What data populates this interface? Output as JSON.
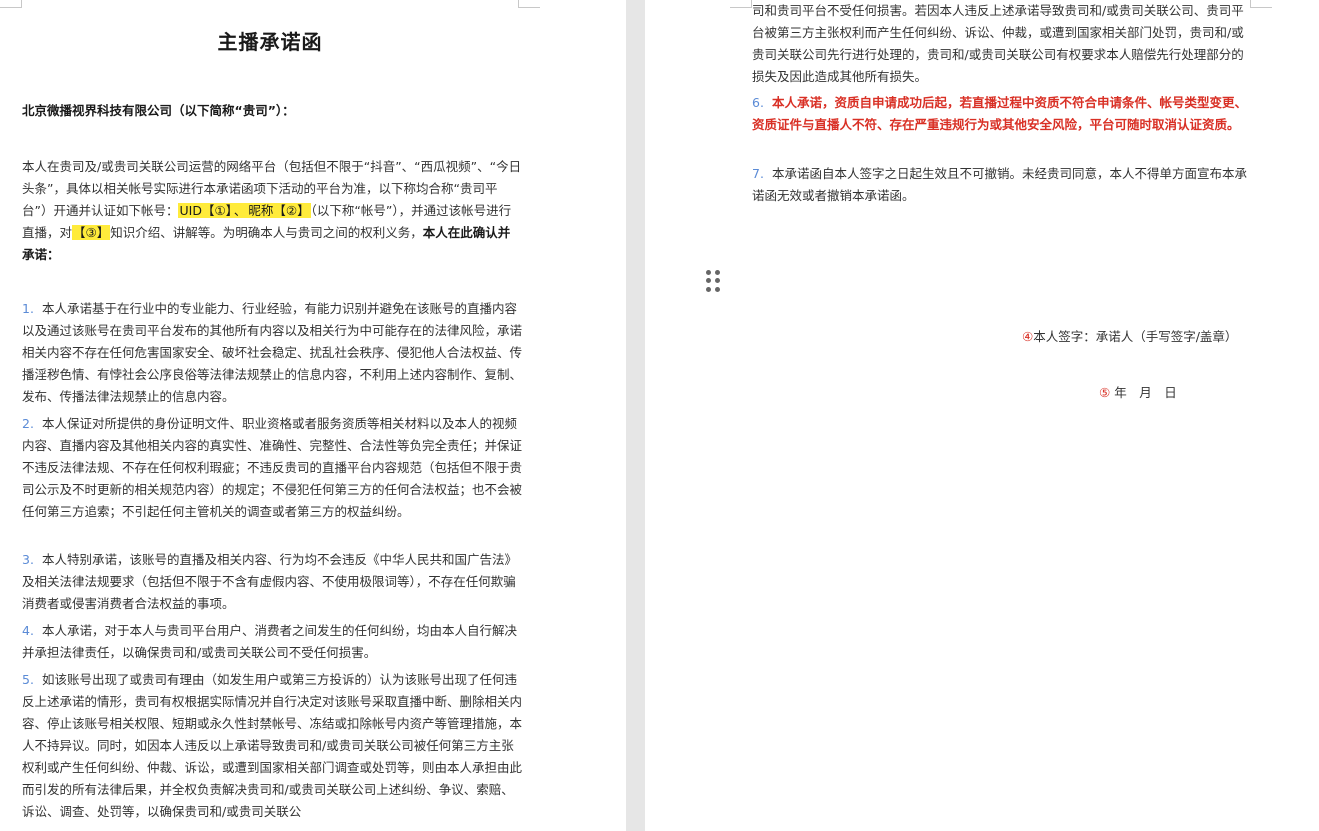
{
  "left_page": {
    "title": "主播承诺函",
    "addressee": "北京微播视界科技有限公司（以下简称“贵司”）：",
    "intro": {
      "part1": "本人在贵司及/或贵司关联公司运营的网络平台（包括但不限于“抖音”、“西瓜视频”、“今日头条”，具体以相关帐号实际进行本承诺函项下活动的平台为准，以下称均合称“贵司平台”）开通并认证如下帐号：",
      "uid_field": "UID【①】",
      "sep": "、",
      "nickname_field": "昵称【②】",
      "part2": "（以下称“帐号”），并通过该帐号进行直播，对",
      "topic_field": "【③】",
      "part3": "知识介绍、讲解等。为明确本人与贵司之间的权利义务，",
      "part4": "本人在此确认并承诺："
    },
    "items": [
      {
        "num": "1.",
        "text": "本人承诺基于在行业中的专业能力、行业经验，有能力识别并避免在该账号的直播内容以及通过该账号在贵司平台发布的其他所有内容以及相关行为中可能存在的法律风险，承诺相关内容不存在任何危害国家安全、破坏社会稳定、扰乱社会秩序、侵犯他人合法权益、传播淫秽色情、有悖社会公序良俗等法律法规禁止的信息内容，不利用上述内容制作、复制、发布、传播法律法规禁止的信息内容。"
      },
      {
        "num": "2.",
        "text": "本人保证对所提供的身份证明文件、职业资格或者服务资质等相关材料以及本人的视频内容、直播内容及其他相关内容的真实性、准确性、完整性、合法性等负完全责任；并保证不违反法律法规、不存在任何权利瑕疵；不违反贵司的直播平台内容规范（包括但不限于贵司公示及不时更新的相关规范内容）的规定；不侵犯任何第三方的任何合法权益；也不会被任何第三方追索；不引起任何主管机关的调查或者第三方的权益纠纷。"
      },
      {
        "num": "3.",
        "text": "本人特别承诺，该账号的直播及相关内容、行为均不会违反《中华人民共和国广告法》及相关法律法规要求（包括但不限于不含有虚假内容、不使用极限词等），不存在任何欺骗消费者或侵害消费者合法权益的事项。"
      },
      {
        "num": "4.",
        "text": "本人承诺，对于本人与贵司平台用户、消费者之间发生的任何纠纷，均由本人自行解决并承担法律责任，以确保贵司和/或贵司关联公司不受任何损害。"
      },
      {
        "num": "5.",
        "text": "如该账号出现了或贵司有理由（如发生用户或第三方投诉的）认为该账号出现了任何违反上述承诺的情形，贵司有权根据实际情况并自行决定对该账号采取直播中断、删除相关内容、停止该账号相关权限、短期或永久性封禁帐号、冻结或扣除帐号内资产等管理措施，本人不持异议。同时，如因本人违反以上承诺导致贵司和/或贵司关联公司被任何第三方主张权利或产生任何纠纷、仲裁、诉讼，或遭到国家相关部门调查或处罚等，则由本人承担由此而引发的所有法律后果，并全权负责解决贵司和/或贵司关联公司上述纠纷、争议、索赔、诉讼、调查、处罚等，以确保贵司和/或贵司关联公"
      }
    ]
  },
  "right_page": {
    "continuation": "司和贵司平台不受任何损害。若因本人违反上述承诺导致贵司和/或贵司关联公司、贵司平台被第三方主张权利而产生任何纠纷、诉讼、仲裁，或遭到国家相关部门处罚，贵司和/或贵司关联公司先行进行处理的，贵司和/或贵司关联公司有权要求本人赔偿先行处理部分的损失及因此造成其他所有损失。",
    "items": [
      {
        "num": "6.",
        "text": "本人承诺，资质自申请成功后起，若直播过程中资质不符合申请条件、帐号类型变更、资质证件与直播人不符、存在严重违规行为或其他安全风险，平台可随时取消认证资质。"
      },
      {
        "num": "7.",
        "text": "本承诺函自本人签字之日起生效且不可撤销。未经贵司同意，本人不得单方面宣布本承诺函无效或者撤销本承诺函。"
      }
    ],
    "signature": {
      "mark": "④",
      "label": "本人签字：承诺人（手写签字/盖章）"
    },
    "date": {
      "mark": "⑤",
      "label": " 年　月　日"
    }
  },
  "colors": {
    "highlight": "#ffeb3b",
    "list_number": "#5b8bd6",
    "warning_red": "#d93025"
  }
}
